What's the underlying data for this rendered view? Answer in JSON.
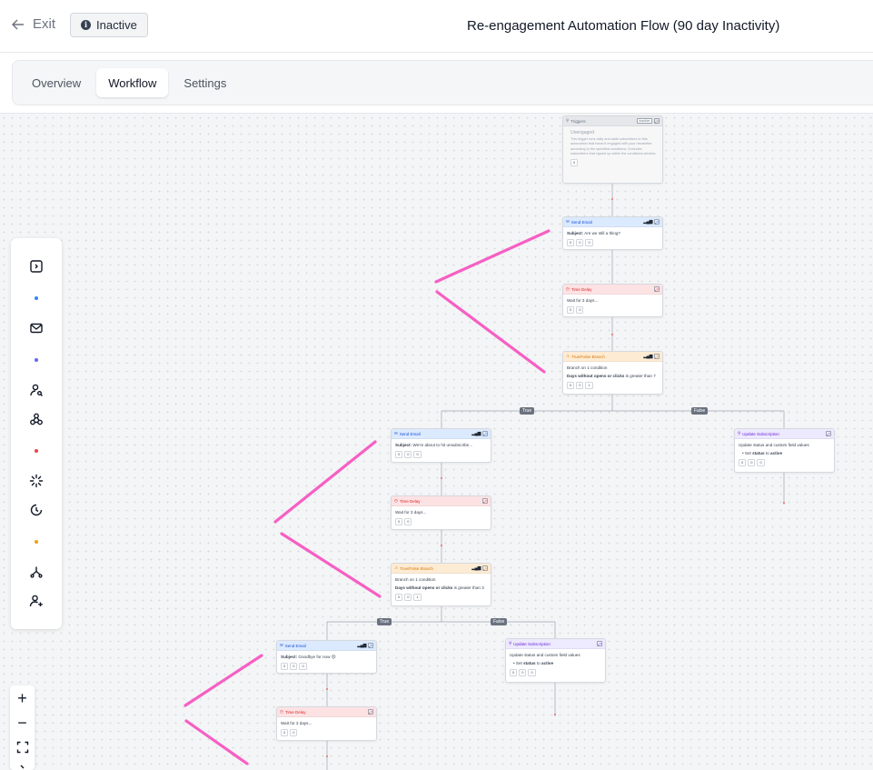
{
  "header": {
    "exit_label": "Exit",
    "status_label": "Inactive",
    "title": "Re-engagement Automation Flow (90 day Inactivity)"
  },
  "tabs": [
    {
      "label": "Overview"
    },
    {
      "label": "Workflow"
    },
    {
      "label": "Settings"
    }
  ],
  "colors": {
    "annotation": "#f65fc4",
    "email": "#dbeafe",
    "delay": "#fde2e4",
    "branch": "#fdebd3",
    "update": "#ede9fe"
  },
  "toolbar": {
    "icons": [
      "panel-toggle-icon",
      "mail-icon",
      "user-search-icon",
      "webhook-icon",
      "loader-icon",
      "clock-icon",
      "branch-icon",
      "user-plus-icon"
    ]
  },
  "zoom": {
    "in": "+",
    "out": "−"
  },
  "flow": {
    "trigger": {
      "title": "Triggers",
      "badge": "Inactive",
      "name": "Unengaged",
      "description": "This trigger runs daily and adds subscribers to this automation that haven't engaged with your newsletter according to the specified conditions. Excludes subscribers that signed up within the conditions window.",
      "count": "0"
    },
    "email1": {
      "title": "Send Email",
      "subject_label": "Subject:",
      "subject": "Are we still a thing?",
      "c1": "0",
      "c2": "0",
      "c3": "0"
    },
    "delay1": {
      "title": "Time Delay",
      "text": "Wait for 3 days...",
      "c1": "0",
      "c2": "0"
    },
    "branch1": {
      "title": "True/False Branch",
      "line1": "Branch on 1 condition",
      "cond_bold": "Days without opens or clicks",
      "cond_rest": "is greater than 7",
      "c1": "0",
      "c2": "0",
      "c3": "1"
    },
    "label_true1": "True",
    "label_false1": "False",
    "email2": {
      "title": "Send Email",
      "subject_label": "Subject:",
      "subject": "We're about to hit unsubscribe...",
      "c1": "0",
      "c2": "0",
      "c3": "0"
    },
    "update1": {
      "title": "Update Subscription",
      "line1": "Update status and custom field values",
      "set": "Set",
      "field": "status",
      "to": "to",
      "value": "active",
      "c1": "0",
      "c2": "0",
      "c3": "0"
    },
    "delay2": {
      "title": "Time Delay",
      "text": "Wait for 3 days...",
      "c1": "0",
      "c2": "0"
    },
    "branch2": {
      "title": "True/False Branch",
      "line1": "Branch on 1 condition",
      "cond_bold": "Days without opens or clicks",
      "cond_rest": "is greater than 3",
      "c1": "0",
      "c2": "0",
      "c3": "1"
    },
    "label_true2": "True",
    "label_false2": "False",
    "email3": {
      "title": "Send Email",
      "subject_label": "Subject:",
      "subject": "Goodbye for now 😢",
      "c1": "0",
      "c2": "0",
      "c3": "0"
    },
    "update2": {
      "title": "Update Subscription",
      "line1": "Update status and custom field values",
      "set": "Set",
      "field": "status",
      "to": "to",
      "value": "active",
      "c1": "0",
      "c2": "0",
      "c3": "0"
    },
    "delay3": {
      "title": "Time Delay",
      "text": "Wait for 3 days...",
      "c1": "0",
      "c2": "0"
    }
  }
}
